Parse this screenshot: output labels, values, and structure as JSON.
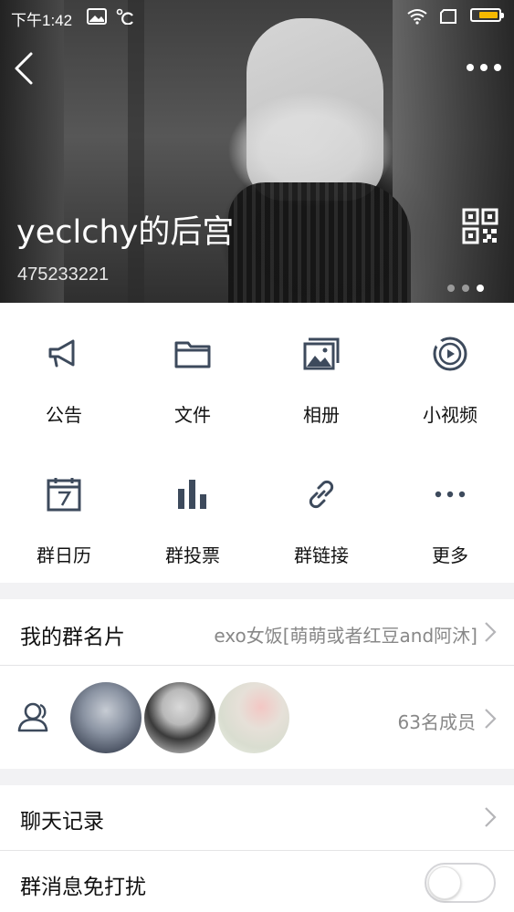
{
  "status_bar": {
    "time": "下午1:42",
    "colors": {
      "battery_fill": "#f5b800"
    }
  },
  "header": {
    "title": "yeclchy的后宫",
    "group_number": "475233221",
    "back_icon": "chevron-left-icon",
    "more_icon": "more-dots-icon",
    "qr_icon": "qr-code-icon",
    "page_count": 3,
    "active_page": 3
  },
  "features": [
    {
      "label": "公告",
      "icon": "announcement-icon"
    },
    {
      "label": "文件",
      "icon": "folder-icon"
    },
    {
      "label": "相册",
      "icon": "album-icon"
    },
    {
      "label": "小视频",
      "icon": "video-icon"
    },
    {
      "label": "群日历",
      "icon": "calendar-icon"
    },
    {
      "label": "群投票",
      "icon": "vote-icon"
    },
    {
      "label": "群链接",
      "icon": "link-icon"
    },
    {
      "label": "更多",
      "icon": "more-icon"
    }
  ],
  "group_card": {
    "label": "我的群名片",
    "value": "exo女饭[萌萌或者红豆and阿沐]"
  },
  "members": {
    "count_label": "63名成员",
    "icon": "members-icon"
  },
  "chat_history": {
    "label": "聊天记录"
  },
  "dnd": {
    "label": "群消息免打扰",
    "enabled": false
  },
  "colors": {
    "icon_stroke": "#3d4a5c",
    "page_bg": "#f2f2f4",
    "text_secondary": "#888888"
  }
}
